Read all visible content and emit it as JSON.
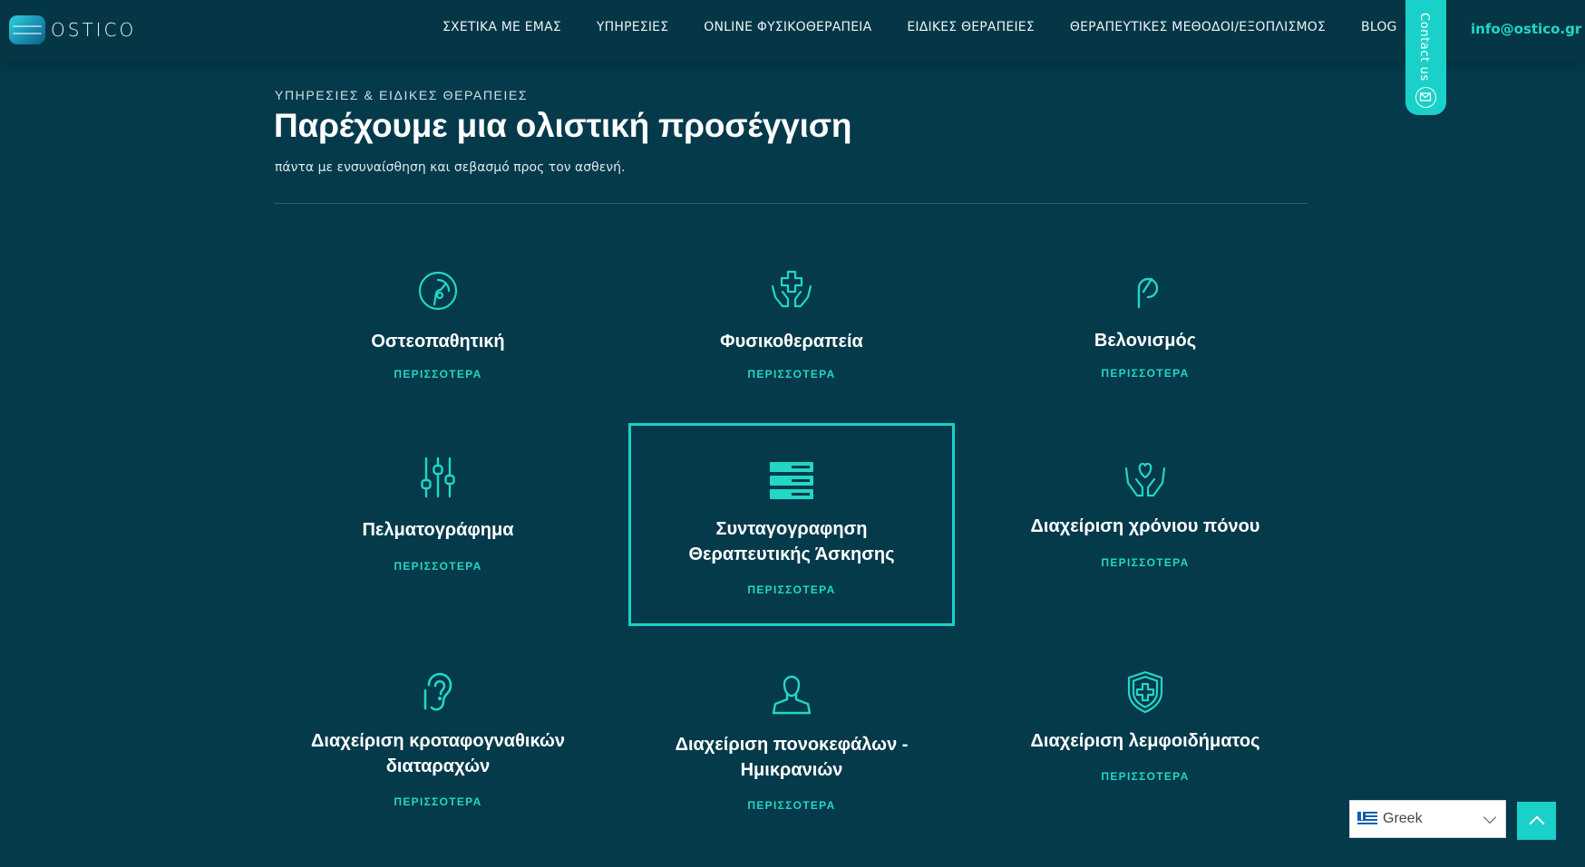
{
  "brand": {
    "logo_text": "OSTICO"
  },
  "nav": {
    "items": [
      {
        "label": "ΣΧΕΤΙΚΑ ΜΕ ΕΜΑΣ"
      },
      {
        "label": "ΥΠΗΡΕΣΙΕΣ"
      },
      {
        "label": "ONLINE ΦΥΣΙΚΟΘΕΡΑΠΕΙΑ"
      },
      {
        "label": "ΕΙΔΙΚΕΣ ΘΕΡΑΠΕΙΕΣ"
      },
      {
        "label": "ΘΕΡΑΠΕΥΤΙΚΕΣ ΜΕΘΟΔΟΙ/ΕΞΟΠΛΙΣΜΟΣ"
      },
      {
        "label": "BLOG"
      }
    ],
    "contact_tab": "Contact us",
    "email": "info@ostico.gr"
  },
  "intro": {
    "kicker": "ΥΠΗΡΕΣΙΕΣ & ΕΙΔΙΚΕΣ ΘΕΡΑΠΕΙΕΣ",
    "title": "Παρέχουμε μια ολιστική προσέγγιση",
    "subtitle": "πάντα με ενσυναίσθηση και σεβασμό προς τον ασθενή."
  },
  "services": [
    {
      "title_line1": "Οστεοπαθητική",
      "title_line2": "",
      "link": "ΠΕΡΙΣΣΟΤΕΡΑ",
      "icon": "osteopathy-icon"
    },
    {
      "title_line1": "Φυσικοθεραπεία",
      "title_line2": "",
      "link": "ΠΕΡΙΣΣΟΤΕΡΑ",
      "icon": "care-hands-icon"
    },
    {
      "title_line1": "Βελονισμός",
      "title_line2": "",
      "link": "ΠΕΡΙΣΣΟΤΕΡΑ",
      "icon": "acupuncture-needle-icon"
    },
    {
      "title_line1": "Πελματογράφημα",
      "title_line2": "",
      "link": "ΠΕΡΙΣΣΟΤΕΡΑ",
      "icon": "sliders-icon"
    },
    {
      "title_line1": "Συνταγογραφηση",
      "title_line2": "Θεραπευτικής Άσκησης",
      "link": "ΠΕΡΙΣΣΟΤΕΡΑ",
      "icon": "stacked-bars-icon"
    },
    {
      "title_line1": "Διαχείριση χρόνιου πόνου",
      "title_line2": "",
      "link": "ΠΕΡΙΣΣΟΤΕΡΑ",
      "icon": "heart-hands-icon"
    },
    {
      "title_line1": "Διαχείριση κροταφογναθικών",
      "title_line2": "διαταραχών",
      "link": "ΠΕΡΙΣΣΟΤΕΡΑ",
      "icon": "ear-icon"
    },
    {
      "title_line1": "Διαχείριση πονοκεφάλων -",
      "title_line2": "Ημικρανιών",
      "link": "ΠΕΡΙΣΣΟΤΕΡΑ",
      "icon": "person-bust-icon"
    },
    {
      "title_line1": "Διαχείριση λεμφοιδήματος",
      "title_line2": "",
      "link": "ΠΕΡΙΣΣΟΤΕΡΑ",
      "icon": "shield-cross-icon"
    }
  ],
  "language": {
    "selected": "Greek"
  },
  "colors": {
    "background": "#053a4b",
    "accent": "#22d7c6",
    "tab": "#19d1c8"
  }
}
